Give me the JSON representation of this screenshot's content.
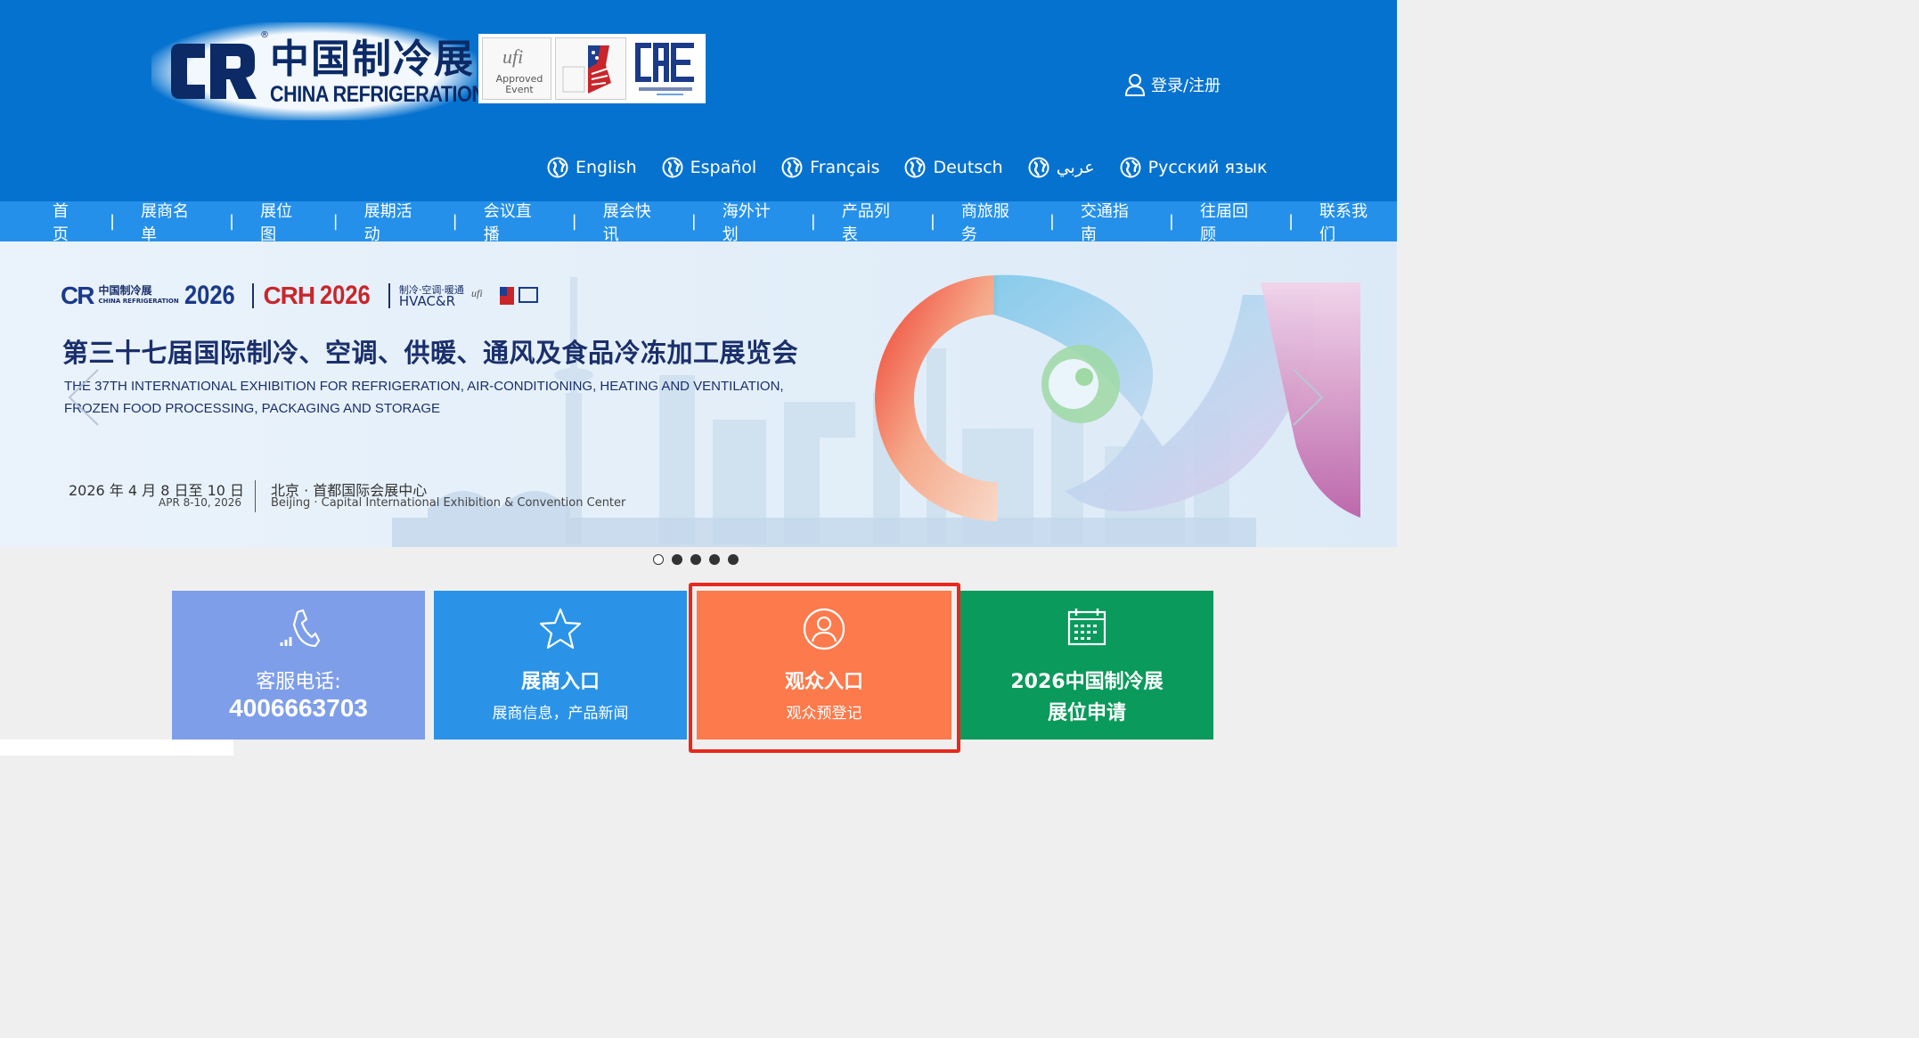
{
  "header": {
    "logo_cn": "中国制冷展",
    "logo_en": "CHINA REFRIGERATION",
    "logo_mark": "CR",
    "cert_ufi_line1": "ufi",
    "cert_ufi_line2": "Approved",
    "cert_ufi_line3": "Event",
    "login_label": "登录/注册",
    "languages": [
      "English",
      "Español",
      "Français",
      "Deutsch",
      "عربي",
      "Русский язык"
    ]
  },
  "nav": {
    "items": [
      "首页",
      "展商名单",
      "展位图",
      "展期活动",
      "会议直播",
      "展会快讯",
      "海外计划",
      "产品列表",
      "商旅服务",
      "交通指南",
      "往届回顾",
      "联系我们"
    ],
    "separator": "|"
  },
  "banner": {
    "logo_cr": "CR",
    "logo_cn_small": "中国制冷展",
    "logo_en_small": "CHINA REFRIGERATION",
    "year1": "2026",
    "logo_crh": "CRH",
    "year2": "2026",
    "hvac_cn": "制冷·空调·暖通",
    "hvac_en": "HVAC&R",
    "title_cn": "第三十七届国际制冷、空调、供暖、通风及食品冷冻加工展览会",
    "title_en_line1": "THE 37TH INTERNATIONAL EXHIBITION FOR REFRIGERATION, AIR-CONDITIONING, HEATING AND VENTILATION,",
    "title_en_line2": "FROZEN FOOD PROCESSING, PACKAGING AND STORAGE",
    "date_cn": "2026 年 4 月 8 日至 10 日",
    "date_en": "APR 8-10, 2026",
    "venue_cn": "北京 · 首都国际会展中心",
    "venue_en": "Beijing · Capital International Exhibition & Convention Center",
    "slide_count": 5,
    "active_slide": 1
  },
  "tiles": {
    "service_title": "客服电话:",
    "service_phone": "4006663703",
    "exhibitor_title": "展商入口",
    "exhibitor_sub": "展商信息，产品新闻",
    "visitor_title": "观众入口",
    "visitor_sub": "观众预登记",
    "booth_title_line1": "2026中国制冷展",
    "booth_title_line2": "展位申请"
  },
  "colors": {
    "header_bg": "#0672cf",
    "nav_bg": "#2490ea",
    "tile_service": "#7e9ee9",
    "tile_exhibitor": "#2a93e8",
    "tile_visitor": "#fd7a4c",
    "tile_booth": "#0a9a5c",
    "highlight": "#e8281c"
  }
}
